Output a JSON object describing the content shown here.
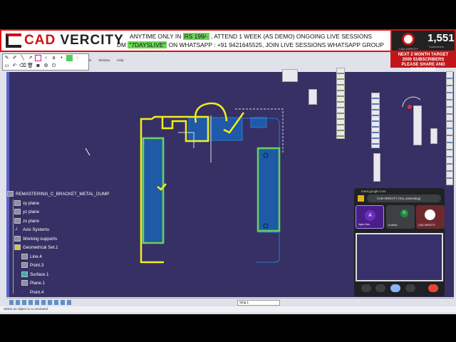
{
  "banner": {
    "brand_a": "CAD ",
    "brand_b": "VERCITY",
    "line1_a": "ANYTIME ONLY IN ",
    "line1_price": "RS 199/-",
    "line1_b": " , ATTEND 1 WEEK (AS DEMO) ONGOING LIVE SESSIONS",
    "line2_a": "DM ",
    "line2_code": "\"7DAYSLIVE\"",
    "line2_b": " ON WHATSAPP : +91 9421645525, JOIN LIVE SESSIONS WHATSAPP GROUP"
  },
  "youtube": {
    "subscribers": "1,551",
    "subscribers_label": "Subscribers",
    "channel": "CAD-VERCITY"
  },
  "target": {
    "line1": "NEXT 2 MONTH TARGET",
    "line2": "2000 SUBSCRIBERS",
    "line3": "PLEASE SHARE AND SUBSCRIBE"
  },
  "menu": [
    "ools",
    "Window",
    "Help"
  ],
  "tree": {
    "root": "REMASTERING_C_BRACKET_METAL_DUMP",
    "items": [
      "xy plane",
      "yz plane",
      "zx plane",
      "Axis Systems",
      "Working supports",
      "Geometrical Set.1",
      "Line.4",
      "Point.3",
      "Surface.1",
      "Plane.1",
      "Point.4"
    ]
  },
  "toolbar": {
    "select_value": "Strip.1"
  },
  "status": "Select an object or a command",
  "meet": {
    "url": "meet.google.com",
    "presenting": "CAD-VERCITY (You, presenting)",
    "tiles": [
      {
        "name": "Agnis Das",
        "initial": "A"
      },
      {
        "name": "5 others",
        "initial": "G"
      },
      {
        "name": "CAD-VERCITY"
      }
    ]
  }
}
